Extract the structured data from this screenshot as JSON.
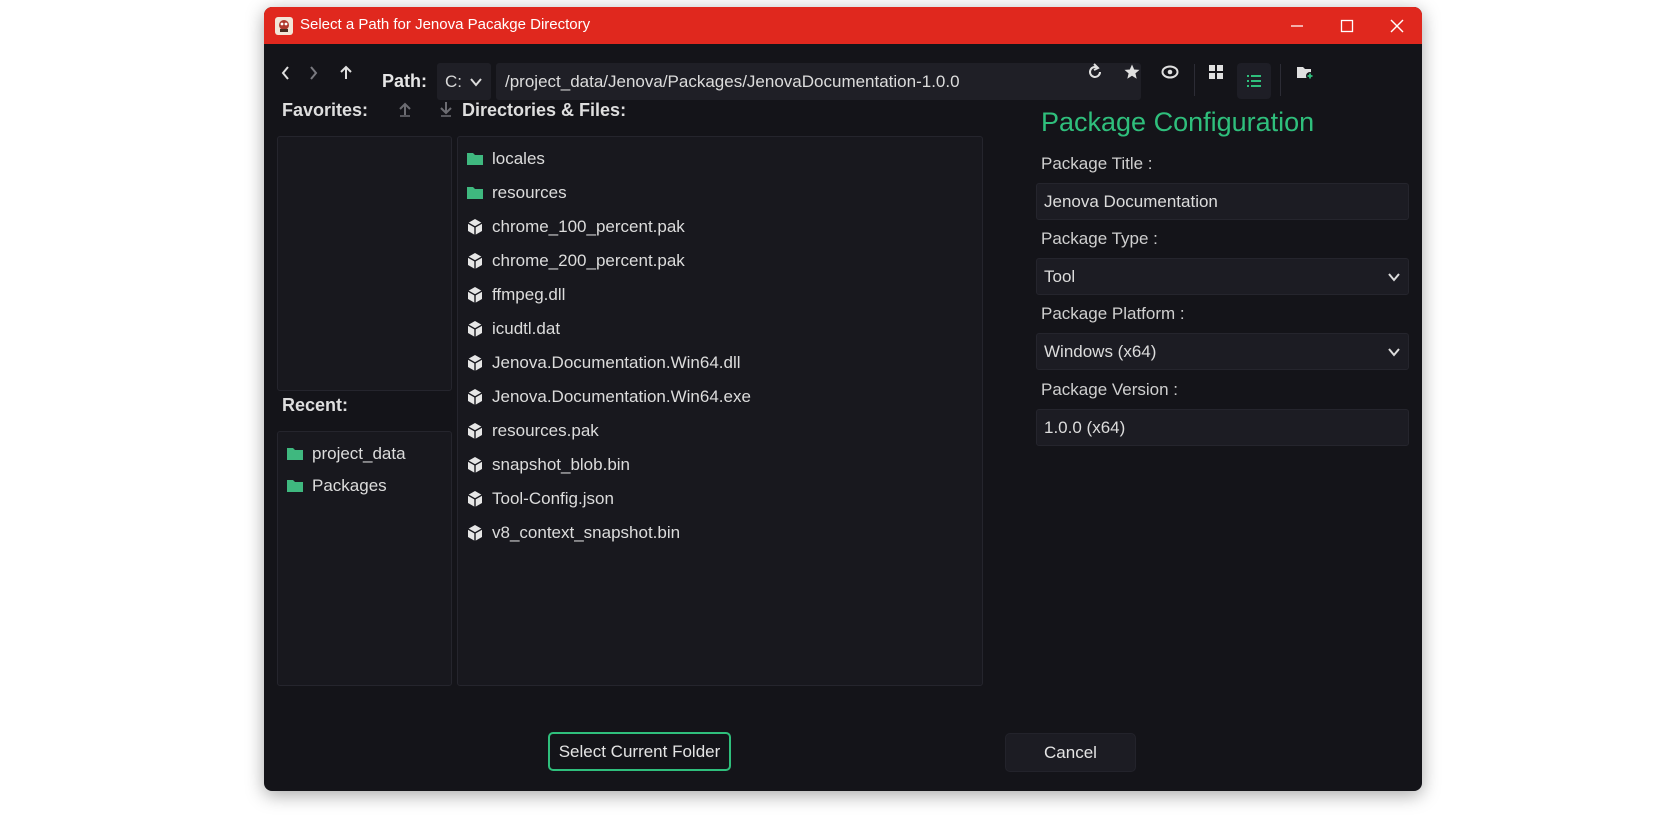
{
  "window": {
    "title": "Select a Path for Jenova Pacakge Directory",
    "accent_color": "#e0281e"
  },
  "toolbar": {
    "path_label": "Path:",
    "drive": "C:",
    "path": "/project_data/Jenova/Packages/JenovaDocumentation-1.0.0"
  },
  "favorites": {
    "label": "Favorites:",
    "items": []
  },
  "recent": {
    "label": "Recent:",
    "items": [
      {
        "label": "project_data",
        "icon": "folder-icon"
      },
      {
        "label": "Packages",
        "icon": "folder-icon"
      }
    ]
  },
  "files": {
    "label": "Directories & Files:",
    "items": [
      {
        "label": "locales",
        "type": "folder"
      },
      {
        "label": "resources",
        "type": "folder"
      },
      {
        "label": "chrome_100_percent.pak",
        "type": "file"
      },
      {
        "label": "chrome_200_percent.pak",
        "type": "file"
      },
      {
        "label": "ffmpeg.dll",
        "type": "file"
      },
      {
        "label": "icudtl.dat",
        "type": "file"
      },
      {
        "label": "Jenova.Documentation.Win64.dll",
        "type": "file"
      },
      {
        "label": "Jenova.Documentation.Win64.exe",
        "type": "file"
      },
      {
        "label": "resources.pak",
        "type": "file"
      },
      {
        "label": "snapshot_blob.bin",
        "type": "file"
      },
      {
        "label": "Tool-Config.json",
        "type": "file"
      },
      {
        "label": "v8_context_snapshot.bin",
        "type": "file"
      }
    ]
  },
  "config": {
    "title": "Package Configuration",
    "title_color": "#2fbf7c",
    "package_title_label": "Package Title :",
    "package_title_value": "Jenova Documentation",
    "package_type_label": "Package Type :",
    "package_type_value": "Tool",
    "package_platform_label": "Package Platform :",
    "package_platform_value": "Windows (x64)",
    "package_version_label": "Package Version :",
    "package_version_value": "1.0.0 (x64)"
  },
  "buttons": {
    "select_label": "Select Current Folder",
    "cancel_label": "Cancel"
  }
}
